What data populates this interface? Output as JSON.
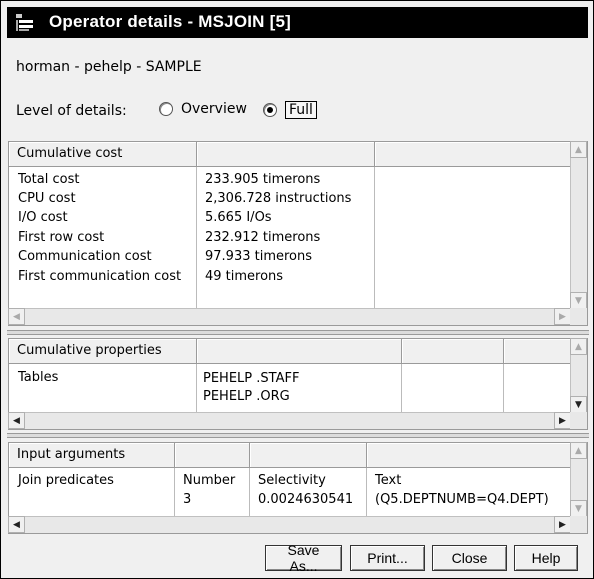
{
  "window": {
    "title": "Operator details - MSJOIN [5]"
  },
  "connection": "horman - pehelp - SAMPLE",
  "level_of_details": {
    "label": "Level of details:",
    "options": [
      "Overview",
      "Full"
    ],
    "selected": "Full"
  },
  "cumulative_cost": {
    "header": "Cumulative cost",
    "rows": [
      {
        "label": "Total cost",
        "value": "233.905 timerons"
      },
      {
        "label": "CPU cost",
        "value": "2,306.728 instructions"
      },
      {
        "label": "I/O cost",
        "value": "5.665 I/Os"
      },
      {
        "label": "First row cost",
        "value": "232.912 timerons"
      },
      {
        "label": "Communication cost",
        "value": "97.933 timerons"
      },
      {
        "label": "First communication cost",
        "value": "49 timerons"
      }
    ]
  },
  "cumulative_properties": {
    "header": "Cumulative properties",
    "row_label": "Tables",
    "tables": [
      "PEHELP .STAFF",
      "PEHELP .ORG"
    ]
  },
  "input_arguments": {
    "header": "Input arguments",
    "row_label": "Join predicates",
    "columns": [
      "Number",
      "Selectivity",
      "Text"
    ],
    "values": [
      "3",
      "0.0024630541",
      "(Q5.DEPTNUMB=Q4.DEPT)"
    ]
  },
  "buttons": {
    "save_as": "Save As...",
    "print": "Print...",
    "close": "Close",
    "help": "Help"
  }
}
